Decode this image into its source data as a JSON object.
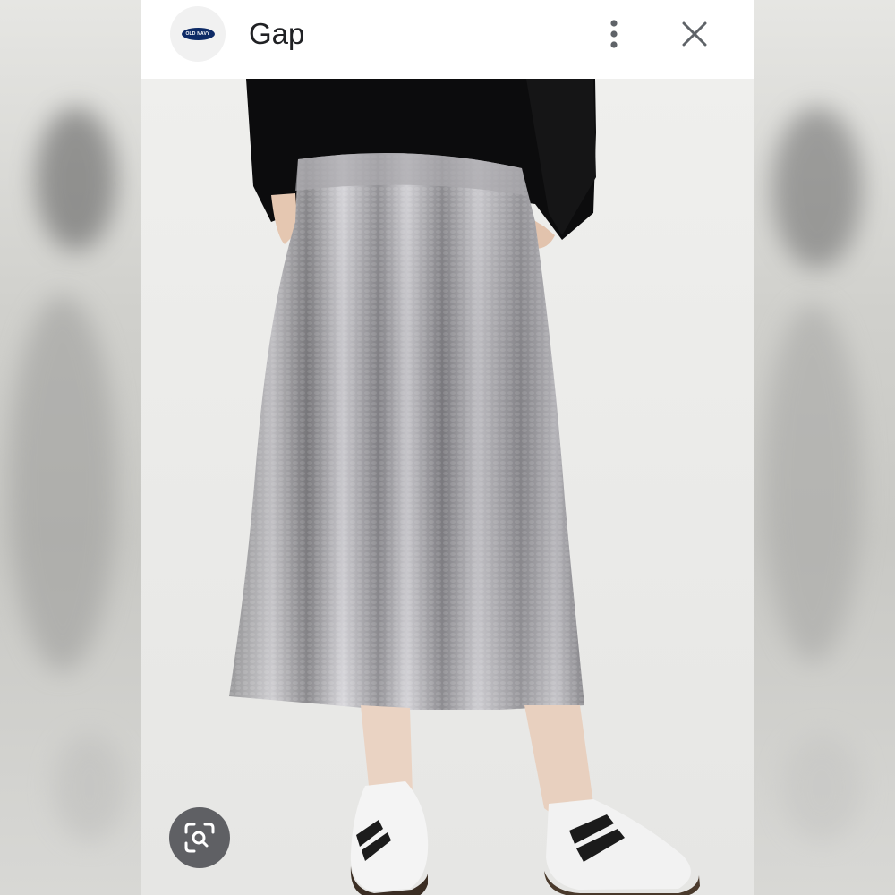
{
  "header": {
    "logo": {
      "icon": "old-navy-logo",
      "text": "OLD NAVY",
      "brand_color": "#0d2a66"
    },
    "title": "Gap",
    "menu_icon": "more-vert-icon",
    "close_icon": "close-icon"
  },
  "image": {
    "subject": "product-photo"
  },
  "lens": {
    "icon": "lens-search-icon"
  }
}
